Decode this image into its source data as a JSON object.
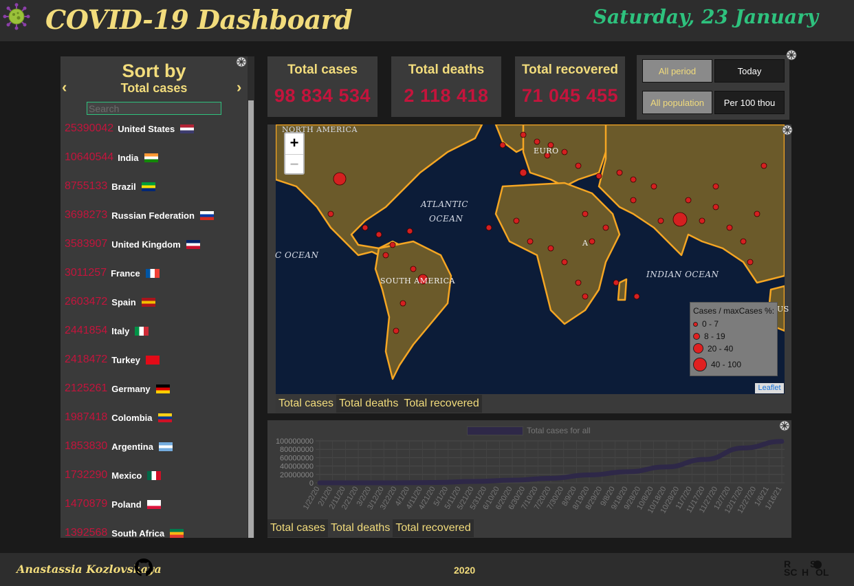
{
  "header": {
    "title": "COVID-19 Dashboard",
    "date": "Saturday, 23 January"
  },
  "sort_panel": {
    "title": "Sort by",
    "subtitle": "Total cases",
    "search_placeholder": "Search",
    "countries": [
      {
        "count": "25390042",
        "name": "United States",
        "flag": "us"
      },
      {
        "count": "10640544",
        "name": "India",
        "flag": "in"
      },
      {
        "count": "8755133",
        "name": "Brazil",
        "flag": "br"
      },
      {
        "count": "3698273",
        "name": "Russian Federation",
        "flag": "ru"
      },
      {
        "count": "3583907",
        "name": "United Kingdom",
        "flag": "gb"
      },
      {
        "count": "3011257",
        "name": "France",
        "flag": "fr"
      },
      {
        "count": "2603472",
        "name": "Spain",
        "flag": "es"
      },
      {
        "count": "2441854",
        "name": "Italy",
        "flag": "it"
      },
      {
        "count": "2418472",
        "name": "Turkey",
        "flag": "tr"
      },
      {
        "count": "2125261",
        "name": "Germany",
        "flag": "de"
      },
      {
        "count": "1987418",
        "name": "Colombia",
        "flag": "co"
      },
      {
        "count": "1853830",
        "name": "Argentina",
        "flag": "ar"
      },
      {
        "count": "1732290",
        "name": "Mexico",
        "flag": "mx"
      },
      {
        "count": "1470879",
        "name": "Poland",
        "flag": "pl"
      },
      {
        "count": "1392568",
        "name": "South Africa",
        "flag": "za"
      }
    ]
  },
  "stats": {
    "cases_label": "Total cases",
    "cases_value": "98 834 534",
    "deaths_label": "Total deaths",
    "deaths_value": "2 118 418",
    "recovered_label": "Total recovered",
    "recovered_value": "71 045 455"
  },
  "toggles": {
    "all_period": "All period",
    "today": "Today",
    "all_population": "All population",
    "per_100": "Per 100 thou"
  },
  "map": {
    "zoom_in": "+",
    "zoom_out": "−",
    "labels": {
      "north_america": "NORTH AMERICA",
      "atlantic_1": "ATLANTIC",
      "atlantic_2": "OCEAN",
      "pacific": "C OCEAN",
      "south_america": "SOUTH AMERICA",
      "indian": "INDIAN OCEAN",
      "europe": "EURO",
      "africa": "A",
      "aus": "US"
    },
    "legend": {
      "title": "Cases / maxCases %:",
      "ranges": [
        "0 - 7",
        "8 - 19",
        "20 - 40",
        "40 - 100"
      ]
    },
    "attribution": "Leaflet",
    "tabs": [
      "Total cases",
      "Total deaths",
      "Total recovered"
    ]
  },
  "chart_data": {
    "type": "line",
    "series": [
      {
        "name": "Total cases for all",
        "values": [
          555,
          9800,
          85000,
          880000,
          3300000,
          6300000,
          10800000,
          18800000,
          26500000,
          37900000,
          55800000,
          83000000,
          98800000
        ]
      }
    ],
    "x": [
      "1/22/20",
      "2/22/20",
      "3/22/20",
      "4/22/20",
      "5/22/20",
      "6/22/20",
      "7/22/20",
      "8/22/20",
      "9/22/20",
      "10/22/20",
      "11/22/20",
      "12/22/20",
      "1/22/21"
    ],
    "tick_labels": [
      "1/22/20",
      "2/1/20",
      "2/11/20",
      "2/21/20",
      "3/2/20",
      "3/12/20",
      "3/22/20",
      "4/1/20",
      "4/11/20",
      "4/21/20",
      "5/1/20",
      "5/11/20",
      "5/21/20",
      "5/31/20",
      "6/10/20",
      "6/20/20",
      "6/30/20",
      "7/10/20",
      "7/20/20",
      "7/30/20",
      "8/9/20",
      "8/19/20",
      "8/29/20",
      "9/8/20",
      "9/18/20",
      "9/28/20",
      "10/8/20",
      "10/18/20",
      "10/28/20",
      "11/7/20",
      "11/17/20",
      "11/27/20",
      "12/7/20",
      "12/17/20",
      "12/27/20",
      "1/6/21",
      "1/16/21"
    ],
    "y_ticks": [
      "100000000",
      "80000000",
      "60000000",
      "40000000",
      "20000000",
      "0"
    ],
    "ylim": [
      0,
      100000000
    ],
    "grid": true,
    "legend": "top"
  },
  "chart_tabs": [
    "Total cases",
    "Total deaths",
    "Total recovered"
  ],
  "colors": {
    "accent_yellow": "#f2dc7c",
    "date_green": "#2ec27e",
    "value_red": "#c4143c",
    "line_color": "#2e2848"
  },
  "footer": {
    "author": "Anastassia Kozlovskaya",
    "year": "2020",
    "logo_text": [
      "R",
      "S",
      "SC",
      "H",
      "OL"
    ]
  }
}
